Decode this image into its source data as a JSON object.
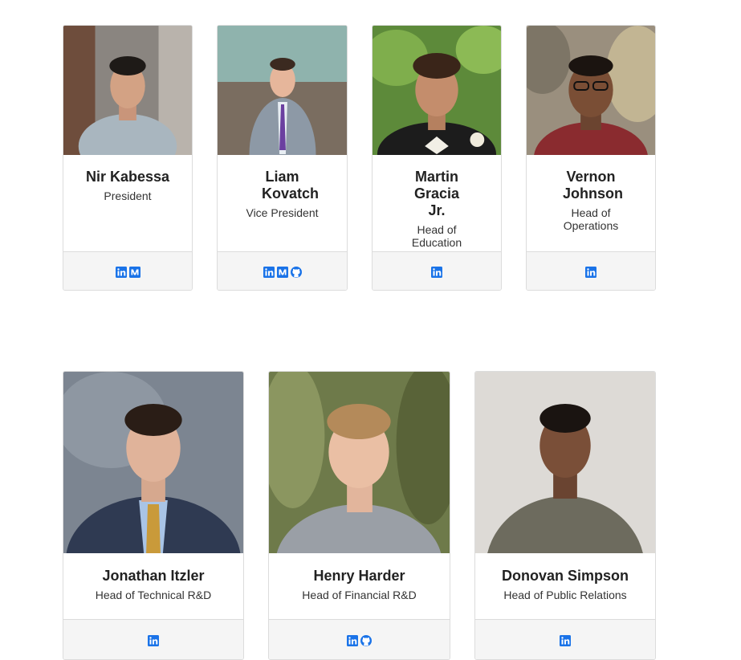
{
  "members_top": [
    {
      "name": "Nir Kabessa",
      "role": "President",
      "icons": [
        "linkedin-icon",
        "medium-icon"
      ]
    },
    {
      "name": "Liam Kovatch",
      "role": "Vice President",
      "icons": [
        "linkedin-icon",
        "medium-icon",
        "github-icon"
      ]
    },
    {
      "name": "Martin Gracia Jr.",
      "role": "Head of Education",
      "icons": [
        "linkedin-icon"
      ]
    },
    {
      "name": "Vernon Johnson",
      "role": "Head of Operations",
      "icons": [
        "linkedin-icon"
      ]
    }
  ],
  "members_bottom": [
    {
      "name": "Jonathan Itzler",
      "role": "Head of Technical R&D",
      "icons": [
        "linkedin-icon"
      ]
    },
    {
      "name": "Henry Harder",
      "role": "Head of Financial R&D",
      "icons": [
        "linkedin-icon",
        "github-icon"
      ]
    },
    {
      "name": "Donovan Simpson",
      "role": "Head of Public Relations",
      "icons": [
        "linkedin-icon"
      ]
    }
  ],
  "colors": {
    "icon_blue": "#1a73e8",
    "footer_bg": "#f5f5f5",
    "border": "#dcdcdc"
  }
}
